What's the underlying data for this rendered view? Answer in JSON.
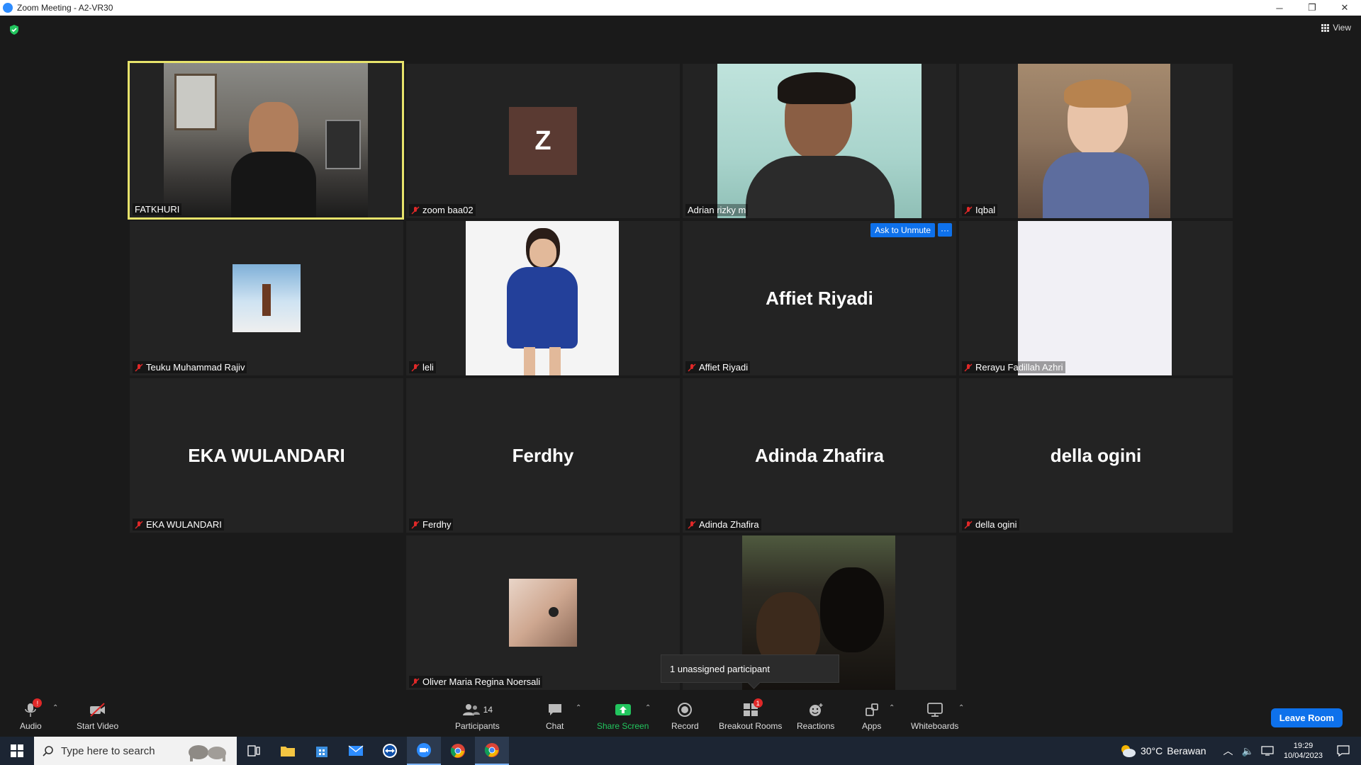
{
  "window": {
    "title": "Zoom Meeting - A2-VR30",
    "minimize": "─",
    "restore": "❐",
    "close": "✕"
  },
  "meeting": {
    "view_label": "View",
    "tiles": [
      {
        "name": "FATKHURI",
        "muted": false,
        "active": true,
        "display": "video"
      },
      {
        "name": "zoom baa02",
        "muted": true,
        "display": "letter",
        "letter": "Z"
      },
      {
        "name": "Adrian rizky m",
        "muted": false,
        "display": "video"
      },
      {
        "name": "Iqbal",
        "muted": true,
        "display": "video"
      },
      {
        "name": "Teuku Muhammad Rajiv",
        "muted": true,
        "display": "photo"
      },
      {
        "name": "leli",
        "muted": true,
        "display": "video"
      },
      {
        "name": "Affiet Riyadi",
        "muted": true,
        "display": "bigname",
        "bigname": "Affiet Riyadi",
        "ask_unmute": "Ask to Unmute",
        "more": "···"
      },
      {
        "name": "Rerayu Fadillah Azhri",
        "muted": true,
        "display": "video"
      },
      {
        "name": "EKA WULANDARI",
        "muted": true,
        "display": "bigname",
        "bigname": "EKA WULANDARI"
      },
      {
        "name": "Ferdhy",
        "muted": true,
        "display": "bigname",
        "bigname": "Ferdhy"
      },
      {
        "name": "Adinda Zhafira",
        "muted": true,
        "display": "bigname",
        "bigname": "Adinda Zhafira"
      },
      {
        "name": "della ogini",
        "muted": true,
        "display": "bigname",
        "bigname": "della ogini"
      },
      {
        "name": "Oliver Maria Regina Noersali",
        "muted": true,
        "display": "photo"
      },
      {
        "name": "",
        "muted": false,
        "display": "video"
      }
    ],
    "popup": "1 unassigned participant"
  },
  "toolbar": {
    "audio": "Audio",
    "audio_badge": "!",
    "start_video": "Start Video",
    "participants": "Participants",
    "participants_count": "14",
    "chat": "Chat",
    "share_screen": "Share Screen",
    "record": "Record",
    "breakout_rooms": "Breakout Rooms",
    "breakout_badge": "1",
    "reactions": "Reactions",
    "apps": "Apps",
    "whiteboards": "Whiteboards",
    "leave": "Leave Room"
  },
  "taskbar": {
    "search_placeholder": "Type here to search",
    "weather_temp": "30°C",
    "weather_desc": "Berawan",
    "time": "19:29",
    "date": "10/04/2023"
  },
  "colors": {
    "active_speaker_border": "#e7e36b",
    "zoom_blue": "#0e71eb",
    "share_green": "#22c55e",
    "badge_red": "#e02828"
  }
}
